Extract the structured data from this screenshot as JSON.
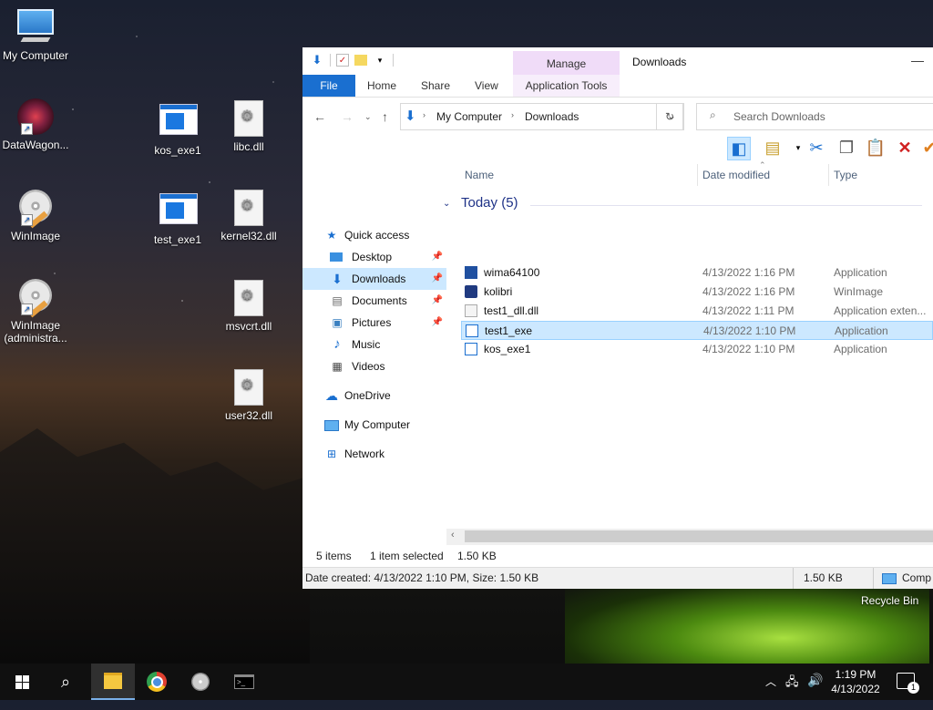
{
  "desktop": {
    "icons": [
      {
        "label": "My Computer"
      },
      {
        "label": "DataWagon..."
      },
      {
        "label": "WinImage"
      },
      {
        "label": "WinImage (administra..."
      },
      {
        "label": "kos_exe1"
      },
      {
        "label": "test_exe1"
      },
      {
        "label": "libc.dll"
      },
      {
        "label": "kernel32.dll"
      },
      {
        "label": "msvcrt.dll"
      },
      {
        "label": "user32.dll"
      }
    ],
    "recycle_bin": "Recycle Bin"
  },
  "explorer": {
    "title": "Downloads",
    "manage_tab": "Manage",
    "ribbon_tabs": [
      "File",
      "Home",
      "Share",
      "View",
      "Application Tools"
    ],
    "breadcrumb": [
      "My Computer",
      "Downloads"
    ],
    "search_placeholder": "Search Downloads",
    "nav": {
      "quick_access": "Quick access",
      "items": [
        "Desktop",
        "Downloads",
        "Documents",
        "Pictures",
        "Music",
        "Videos"
      ],
      "onedrive": "OneDrive",
      "my_computer": "My Computer",
      "network": "Network"
    },
    "columns": [
      "Name",
      "Date modified",
      "Type"
    ],
    "group": "Today (5)",
    "files": [
      {
        "name": "wima64100",
        "date": "4/13/2022 1:16 PM",
        "type": "Application"
      },
      {
        "name": "kolibri",
        "date": "4/13/2022 1:16 PM",
        "type": "WinImage"
      },
      {
        "name": "test1_dll.dll",
        "date": "4/13/2022 1:11 PM",
        "type": "Application exten..."
      },
      {
        "name": "test1_exe",
        "date": "4/13/2022 1:10 PM",
        "type": "Application"
      },
      {
        "name": "kos_exe1",
        "date": "4/13/2022 1:10 PM",
        "type": "Application"
      }
    ],
    "status": {
      "items": "5 items",
      "selected": "1 item selected",
      "size": "1.50 KB"
    },
    "details": {
      "text": "Date created: 4/13/2022 1:10 PM, Size: 1.50 KB",
      "size": "1.50 KB",
      "location": "Comp"
    }
  },
  "taskbar": {
    "time": "1:19 PM",
    "date": "4/13/2022",
    "notification_count": "1"
  }
}
